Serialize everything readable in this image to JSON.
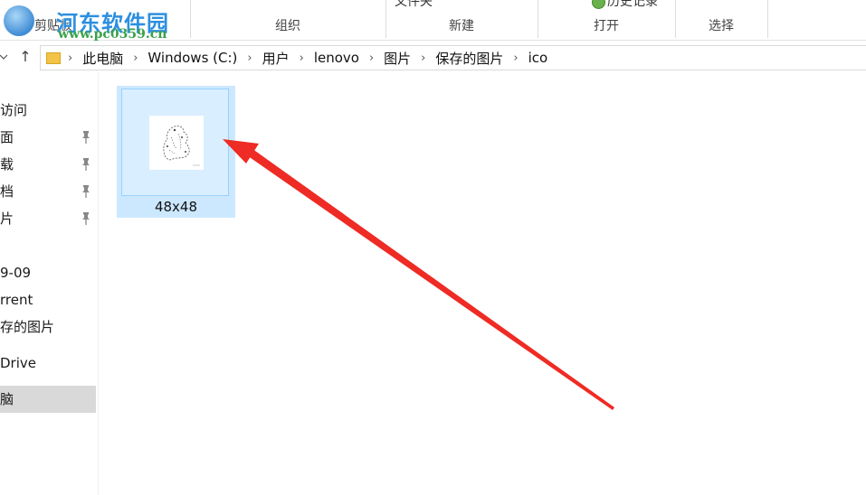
{
  "ribbon": {
    "groups": [
      {
        "label": "剪贴板"
      },
      {
        "label": "组织"
      },
      {
        "label": "新建",
        "partial_above": "文件夹"
      },
      {
        "label": "打开",
        "partial_above": "历史记录"
      },
      {
        "label": "选择"
      }
    ]
  },
  "watermark": {
    "title": "河东软件园",
    "url": "www.pc0359.cn"
  },
  "navigation": {
    "up_arrow": "↑"
  },
  "address_bar": {
    "crumbs": [
      "此电脑",
      "Windows (C:)",
      "用户",
      "lenovo",
      "图片",
      "保存的图片",
      "ico"
    ]
  },
  "sidebar": {
    "items": [
      {
        "label": "访问",
        "pinned": false
      },
      {
        "label": "面",
        "pinned": true
      },
      {
        "label": "载",
        "pinned": true
      },
      {
        "label": "档",
        "pinned": true
      },
      {
        "label": "片",
        "pinned": true
      },
      {
        "label": "9-09",
        "pinned": false
      },
      {
        "label": "rrent",
        "pinned": false
      },
      {
        "label": "存的图片",
        "pinned": false
      },
      {
        "label": "Drive",
        "pinned": false
      },
      {
        "label": "脑",
        "pinned": false,
        "selected": true
      }
    ]
  },
  "files": [
    {
      "name": "48x48",
      "selected": true
    }
  ],
  "colors": {
    "selection": "#cce8ff",
    "selection_border": "#99d1ff",
    "annotation_arrow": "#ee2b24"
  }
}
